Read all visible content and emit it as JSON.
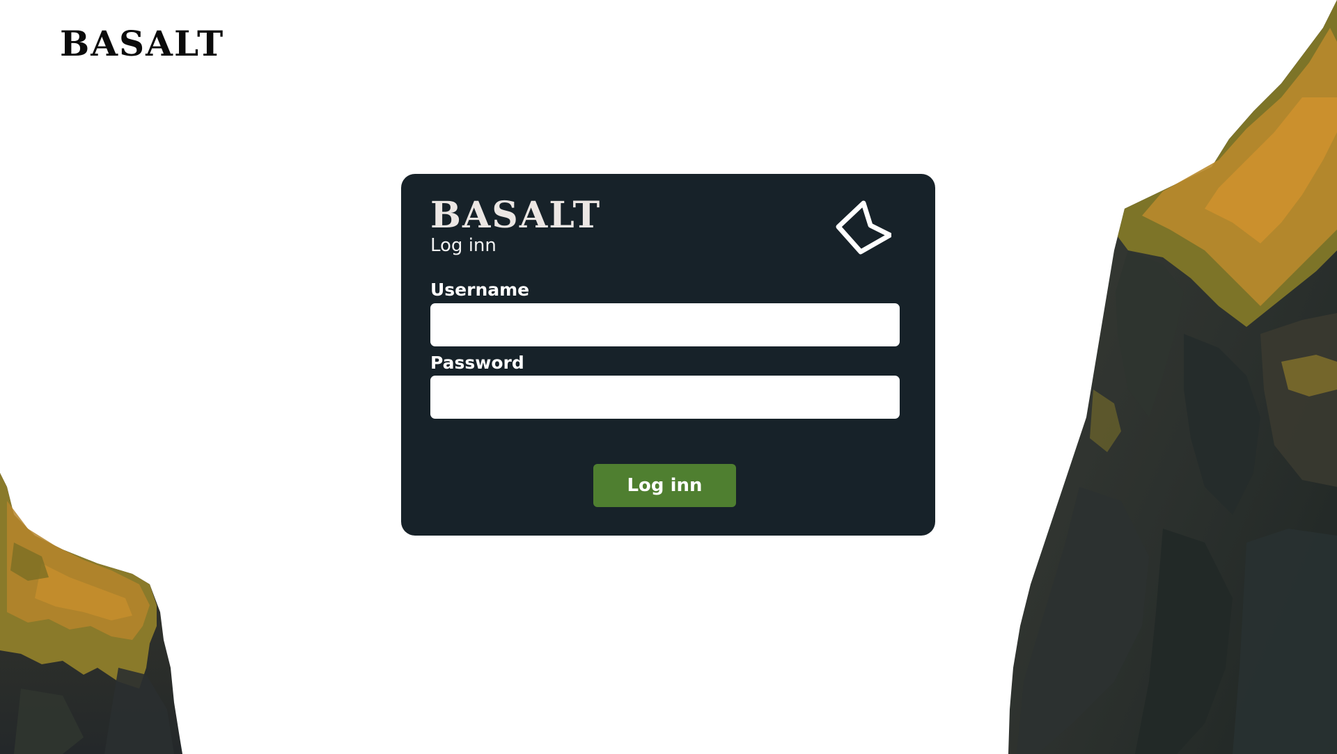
{
  "header": {
    "brand": "BASALT"
  },
  "login": {
    "brand": "BASALT",
    "subtitle": "Log inn",
    "logo_icon": "basalt-b-logo-icon",
    "username_label": "Username",
    "username_value": "",
    "password_label": "Password",
    "password_value": "",
    "submit_label": "Log inn"
  },
  "colors": {
    "card_background": "#172229",
    "button_background": "#4f7f30",
    "page_background": "#ffffff",
    "moss": "#b07a22",
    "rock": "#2c332f"
  }
}
